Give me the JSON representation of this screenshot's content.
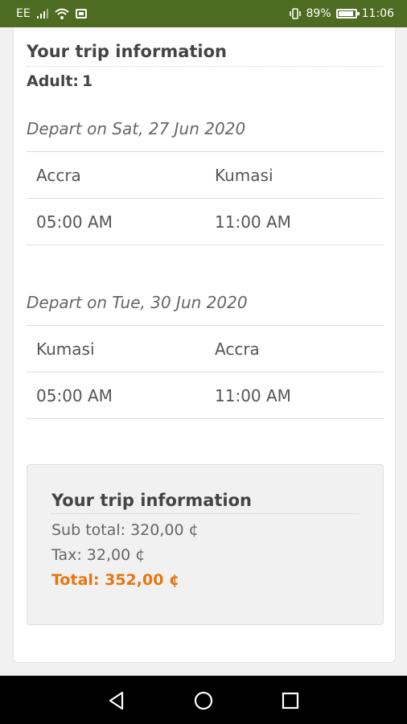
{
  "status_bar": {
    "carrier": "EE",
    "battery_percent": "89%",
    "battery_level": 0.89,
    "time": "11:06",
    "icons": [
      "signal-icon",
      "wifi-icon",
      "sim-icon",
      "vibrate-icon",
      "battery-icon"
    ]
  },
  "trip": {
    "title": "Your trip information",
    "adult_label": "Adult:",
    "adult_count": "1",
    "legs": [
      {
        "depart": "Depart on Sat, 27 Jun 2020",
        "from": "Accra",
        "to": "Kumasi",
        "depart_time": "05:00 AM",
        "arrive_time": "11:00 AM"
      },
      {
        "depart": "Depart on Tue, 30 Jun 2020",
        "from": "Kumasi",
        "to": "Accra",
        "depart_time": "05:00 AM",
        "arrive_time": "11:00 AM"
      }
    ]
  },
  "summary": {
    "title": "Your trip information",
    "sub_total": "Sub total: 320,00 ¢",
    "tax": "Tax: 32,00 ¢",
    "total": "Total: 352,00 ¢",
    "total_color": "#e77611"
  },
  "nav_bar": {
    "icons": [
      "back-icon",
      "home-icon",
      "recents-icon"
    ]
  },
  "colors": {
    "status_bar_bg": "#4e6b22",
    "nav_bar_bg": "#000000"
  }
}
